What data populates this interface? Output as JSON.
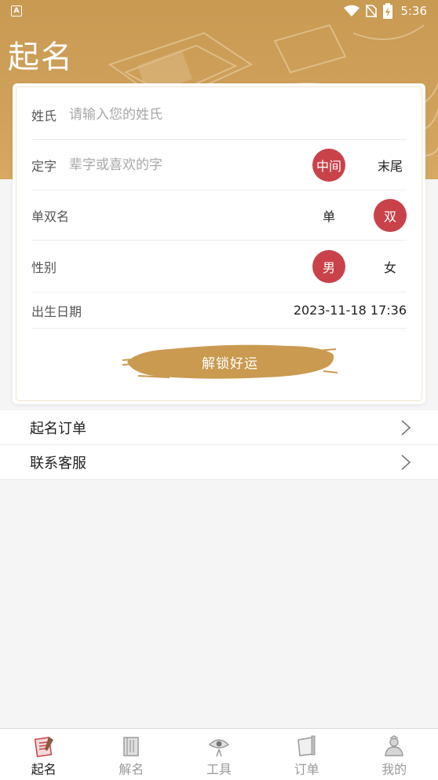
{
  "status_bar": {
    "notification_letter": "A",
    "time": "5:36"
  },
  "header": {
    "title": "起名"
  },
  "form": {
    "surname": {
      "label": "姓氏",
      "placeholder": "请输入您的姓氏",
      "value": ""
    },
    "fixed_char": {
      "label": "定字",
      "placeholder": "辈字或喜欢的字",
      "value": "",
      "options": [
        "中间",
        "末尾"
      ],
      "selected": "中间"
    },
    "name_length": {
      "label": "单双名",
      "options": [
        "单",
        "双"
      ],
      "selected": "双"
    },
    "gender": {
      "label": "性别",
      "options": [
        "男",
        "女"
      ],
      "selected": "男"
    },
    "birth_date": {
      "label": "出生日期",
      "value": "2023-11-18 17:36"
    },
    "submit_label": "解锁好运"
  },
  "menu": {
    "items": [
      {
        "label": "起名订单"
      },
      {
        "label": "联系客服"
      }
    ]
  },
  "bottom_nav": {
    "items": [
      {
        "label": "起名",
        "icon": "naming-icon",
        "active": true
      },
      {
        "label": "解名",
        "icon": "book-icon",
        "active": false
      },
      {
        "label": "工具",
        "icon": "eye-fan-icon",
        "active": false
      },
      {
        "label": "订单",
        "icon": "scroll-icon",
        "active": false
      },
      {
        "label": "我的",
        "icon": "profile-icon",
        "active": false
      }
    ]
  },
  "colors": {
    "header_gold": "#cfa05a",
    "accent_red": "#c9424a",
    "button_gold": "#c99a50",
    "background": "#f5f5f5"
  }
}
